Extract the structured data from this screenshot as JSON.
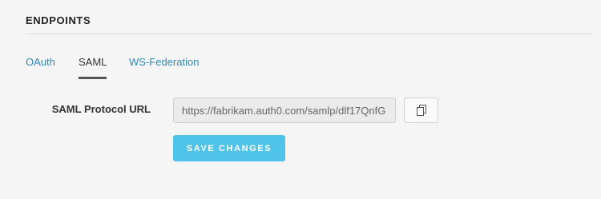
{
  "section": {
    "title": "ENDPOINTS"
  },
  "tabs": [
    {
      "label": "OAuth",
      "active": false
    },
    {
      "label": "SAML",
      "active": true
    },
    {
      "label": "WS-Federation",
      "active": false
    }
  ],
  "form": {
    "saml_label": "SAML Protocol URL",
    "saml_url_value": "https://fabrikam.auth0.com/samlp/dlf17QnfG",
    "copy_icon": "copy-icon",
    "save_label": "SAVE CHANGES"
  },
  "colors": {
    "link": "#2f88b8",
    "active_tab_underline": "#555555",
    "primary_button": "#4fc3ea",
    "background": "#f5f5f5"
  }
}
